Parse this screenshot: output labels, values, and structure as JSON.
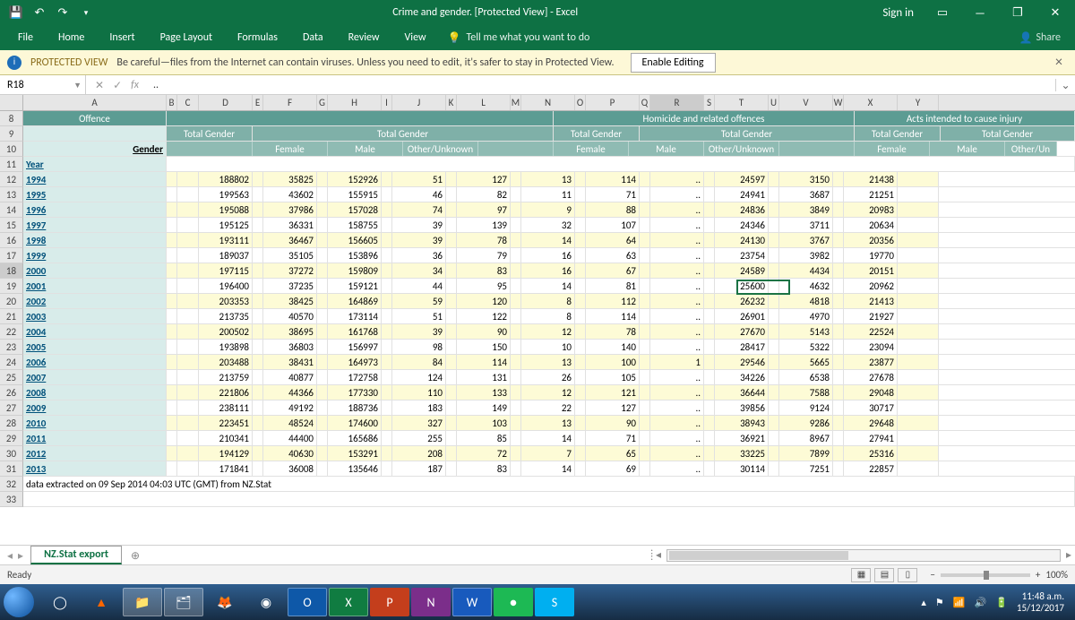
{
  "titlebar": {
    "title": "Crime and gender.  [Protected View]  -  Excel",
    "signin": "Sign in"
  },
  "ribbon": {
    "tabs": [
      "File",
      "Home",
      "Insert",
      "Page Layout",
      "Formulas",
      "Data",
      "Review",
      "View"
    ],
    "tell": "Tell me what you want to do",
    "share": "Share"
  },
  "protected": {
    "label": "PROTECTED VIEW",
    "msg": "Be careful—files from the Internet can contain viruses. Unless you need to edit, it's safer to stay in Protected View.",
    "enable": "Enable Editing"
  },
  "formula": {
    "name": "R18",
    "value": ".."
  },
  "colLetters": [
    "A",
    "B",
    "C",
    "D",
    "E",
    "F",
    "G",
    "H",
    "I",
    "J",
    "K",
    "L",
    "M",
    "N",
    "O",
    "P",
    "Q",
    "R",
    "S",
    "T",
    "U",
    "V",
    "W",
    "X",
    "Y"
  ],
  "rowNums": [
    "8",
    "9",
    "10",
    "11",
    "12",
    "13",
    "14",
    "15",
    "16",
    "17",
    "18",
    "19",
    "20",
    "21",
    "22",
    "23",
    "24",
    "25",
    "26",
    "27",
    "28",
    "29",
    "30",
    "31",
    "32",
    "33"
  ],
  "headers": {
    "offence": "Offence",
    "section2": "Homicide and related offences",
    "section3": "Acts intended to cause injury",
    "gender": "Gender",
    "total": "Total Gender",
    "female": "Female",
    "male": "Male",
    "other": "Other/Unknown",
    "otherShort": "Other/Un",
    "year": "Year"
  },
  "rows": [
    {
      "y": "1994",
      "d": "188802",
      "f": "35825",
      "h": "152926",
      "j": "51",
      "l": "127",
      "n": "13",
      "p": "114",
      "r": "..",
      "t": "24597",
      "v": "3150",
      "x": "21438"
    },
    {
      "y": "1995",
      "d": "199563",
      "f": "43602",
      "h": "155915",
      "j": "46",
      "l": "82",
      "n": "11",
      "p": "71",
      "r": "..",
      "t": "24941",
      "v": "3687",
      "x": "21251"
    },
    {
      "y": "1996",
      "d": "195088",
      "f": "37986",
      "h": "157028",
      "j": "74",
      "l": "97",
      "n": "9",
      "p": "88",
      "r": "..",
      "t": "24836",
      "v": "3849",
      "x": "20983"
    },
    {
      "y": "1997",
      "d": "195125",
      "f": "36331",
      "h": "158755",
      "j": "39",
      "l": "139",
      "n": "32",
      "p": "107",
      "r": "..",
      "t": "24346",
      "v": "3711",
      "x": "20634"
    },
    {
      "y": "1998",
      "d": "193111",
      "f": "36467",
      "h": "156605",
      "j": "39",
      "l": "78",
      "n": "14",
      "p": "64",
      "r": "..",
      "t": "24130",
      "v": "3767",
      "x": "20356"
    },
    {
      "y": "1999",
      "d": "189037",
      "f": "35105",
      "h": "153896",
      "j": "36",
      "l": "79",
      "n": "16",
      "p": "63",
      "r": "..",
      "t": "23754",
      "v": "3982",
      "x": "19770"
    },
    {
      "y": "2000",
      "d": "197115",
      "f": "37272",
      "h": "159809",
      "j": "34",
      "l": "83",
      "n": "16",
      "p": "67",
      "r": "..",
      "t": "24589",
      "v": "4434",
      "x": "20151"
    },
    {
      "y": "2001",
      "d": "196400",
      "f": "37235",
      "h": "159121",
      "j": "44",
      "l": "95",
      "n": "14",
      "p": "81",
      "r": "..",
      "t": "25600",
      "v": "4632",
      "x": "20962"
    },
    {
      "y": "2002",
      "d": "203353",
      "f": "38425",
      "h": "164869",
      "j": "59",
      "l": "120",
      "n": "8",
      "p": "112",
      "r": "..",
      "t": "26232",
      "v": "4818",
      "x": "21413"
    },
    {
      "y": "2003",
      "d": "213735",
      "f": "40570",
      "h": "173114",
      "j": "51",
      "l": "122",
      "n": "8",
      "p": "114",
      "r": "..",
      "t": "26901",
      "v": "4970",
      "x": "21927"
    },
    {
      "y": "2004",
      "d": "200502",
      "f": "38695",
      "h": "161768",
      "j": "39",
      "l": "90",
      "n": "12",
      "p": "78",
      "r": "..",
      "t": "27670",
      "v": "5143",
      "x": "22524"
    },
    {
      "y": "2005",
      "d": "193898",
      "f": "36803",
      "h": "156997",
      "j": "98",
      "l": "150",
      "n": "10",
      "p": "140",
      "r": "..",
      "t": "28417",
      "v": "5322",
      "x": "23094"
    },
    {
      "y": "2006",
      "d": "203488",
      "f": "38431",
      "h": "164973",
      "j": "84",
      "l": "114",
      "n": "13",
      "p": "100",
      "r": "1",
      "t": "29546",
      "v": "5665",
      "x": "23877"
    },
    {
      "y": "2007",
      "d": "213759",
      "f": "40877",
      "h": "172758",
      "j": "124",
      "l": "131",
      "n": "26",
      "p": "105",
      "r": "..",
      "t": "34226",
      "v": "6538",
      "x": "27678"
    },
    {
      "y": "2008",
      "d": "221806",
      "f": "44366",
      "h": "177330",
      "j": "110",
      "l": "133",
      "n": "12",
      "p": "121",
      "r": "..",
      "t": "36644",
      "v": "7588",
      "x": "29048"
    },
    {
      "y": "2009",
      "d": "238111",
      "f": "49192",
      "h": "188736",
      "j": "183",
      "l": "149",
      "n": "22",
      "p": "127",
      "r": "..",
      "t": "39856",
      "v": "9124",
      "x": "30717"
    },
    {
      "y": "2010",
      "d": "223451",
      "f": "48524",
      "h": "174600",
      "j": "327",
      "l": "103",
      "n": "13",
      "p": "90",
      "r": "..",
      "t": "38943",
      "v": "9286",
      "x": "29648"
    },
    {
      "y": "2011",
      "d": "210341",
      "f": "44400",
      "h": "165686",
      "j": "255",
      "l": "85",
      "n": "14",
      "p": "71",
      "r": "..",
      "t": "36921",
      "v": "8967",
      "x": "27941"
    },
    {
      "y": "2012",
      "d": "194129",
      "f": "40630",
      "h": "153291",
      "j": "208",
      "l": "72",
      "n": "7",
      "p": "65",
      "r": "..",
      "t": "33225",
      "v": "7899",
      "x": "25316"
    },
    {
      "y": "2013",
      "d": "171841",
      "f": "36008",
      "h": "135646",
      "j": "187",
      "l": "83",
      "n": "14",
      "p": "69",
      "r": "..",
      "t": "30114",
      "v": "7251",
      "x": "22857"
    }
  ],
  "footerNote": "data extracted on 09 Sep 2014 04:03 UTC (GMT) from NZ.Stat",
  "sheetTab": "NZ.Stat export",
  "status": {
    "ready": "Ready",
    "zoom": "100%"
  },
  "clock": {
    "time": "11:48 a.m.",
    "date": "15/12/2017"
  }
}
